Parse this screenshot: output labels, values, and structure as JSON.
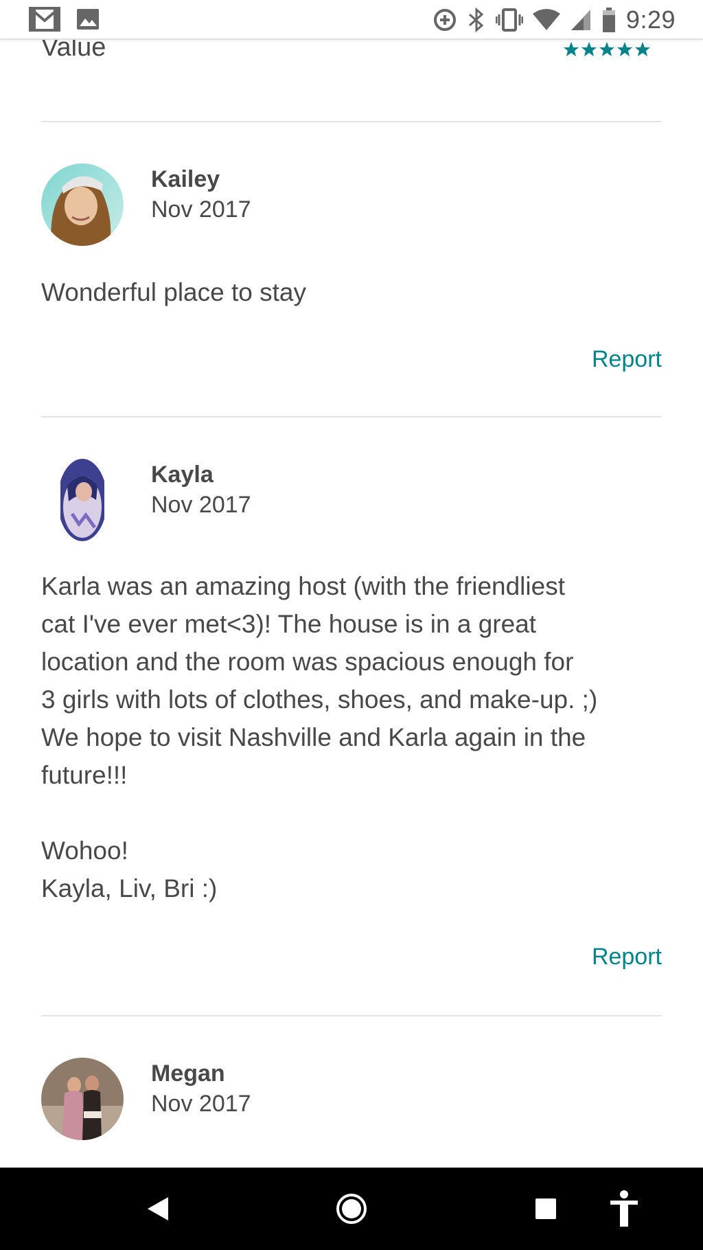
{
  "status_bar": {
    "time": "9:29",
    "left_icons": [
      "gmail-icon",
      "image-icon"
    ],
    "right_icons": [
      "data-saver-icon",
      "bluetooth-icon",
      "vibrate-icon",
      "wifi-icon",
      "signal-icon",
      "battery-icon"
    ]
  },
  "rating": {
    "label": "Value",
    "stars": 5,
    "star_color": "#008489"
  },
  "reviews": [
    {
      "name": "Kailey",
      "date": "Nov 2017",
      "text": "Wonderful place to stay",
      "report_label": "Report"
    },
    {
      "name": "Kayla",
      "date": "Nov 2017",
      "text": "Karla was an amazing host (with the friendliest\ncat I've ever met<3)! The house is in a great\nlocation and the room was spacious enough for\n3 girls with lots of clothes, shoes, and make-up. ;)\nWe hope to visit Nashville and Karla again in the\nfuture!!!\n\nWohoo!\nKayla, Liv, Bri :)",
      "report_label": "Report"
    },
    {
      "name": "Megan",
      "date": "Nov 2017"
    }
  ],
  "colors": {
    "accent": "#008489",
    "text": "#484848",
    "divider": "#e4e4e4",
    "nav_background": "#000000"
  },
  "nav_bar": {
    "buttons": [
      "back-icon",
      "home-icon",
      "recents-icon",
      "accessibility-icon"
    ]
  }
}
